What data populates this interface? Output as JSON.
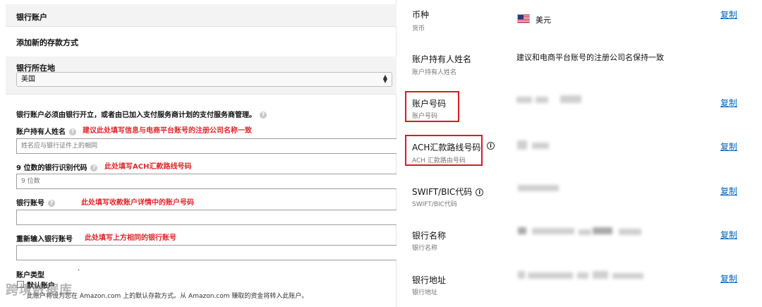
{
  "left": {
    "section_title": "银行账户",
    "add_method": "添加新的存款方式",
    "location": {
      "label": "银行所在地",
      "value": "美国"
    },
    "notice": "银行账户必须由银行开立，或者由已加入支付服务商计划的支付服务商管理。",
    "fields": [
      {
        "label": "账户持有人姓名",
        "note": "建议此处填写信息与电商平台账号的注册公司名称一致",
        "placeholder": "姓名应与银行证件上的相同"
      },
      {
        "label": "9 位数的银行识别代码",
        "note": "此处填写ACH汇款路线号码",
        "placeholder": "9 位数"
      },
      {
        "label": "银行账号",
        "note": "此处填写收款账户详情中的账户号码",
        "placeholder": ""
      },
      {
        "label": "重新输入银行账号",
        "note": "此处填写上方相同的银行账号",
        "placeholder": ""
      }
    ],
    "account_type_label": "账户类型",
    "account_type_value": "·",
    "default_label": "默认账户",
    "footnote": "此账户将设为您在 Amazon.com 上的默认存款方式。从 Amazon.com 赚取的资金将转入此账户。",
    "watermark": "跨境数据库"
  },
  "right": {
    "copy_label": "复制",
    "rows": [
      {
        "label": "币种",
        "sub": "货币",
        "value": "美元"
      },
      {
        "label": "账户持有人姓名",
        "sub": "账户持有人姓名",
        "value": "建议和电商平台账号的注册公司名保持一致"
      },
      {
        "label": "账户号码",
        "sub": "账户号码",
        "value": ""
      },
      {
        "label": "ACH汇款路线号码",
        "sub": "ACH 汇款路由号码",
        "value": ""
      },
      {
        "label": "SWIFT/BIC代码",
        "sub": "SWIFT/BIC代码",
        "value": ""
      },
      {
        "label": "银行名称",
        "sub": "银行名称",
        "value": ""
      },
      {
        "label": "银行地址",
        "sub": "银行地址",
        "value": ""
      }
    ]
  },
  "icons": {
    "help": "?",
    "info": "i",
    "select_arrows": "⌃⌄",
    "flag": "us-flag-icon"
  },
  "colors": {
    "link": "#0066c0",
    "annotation_red": "#e0282c",
    "highlight_box": "#d81b27"
  }
}
